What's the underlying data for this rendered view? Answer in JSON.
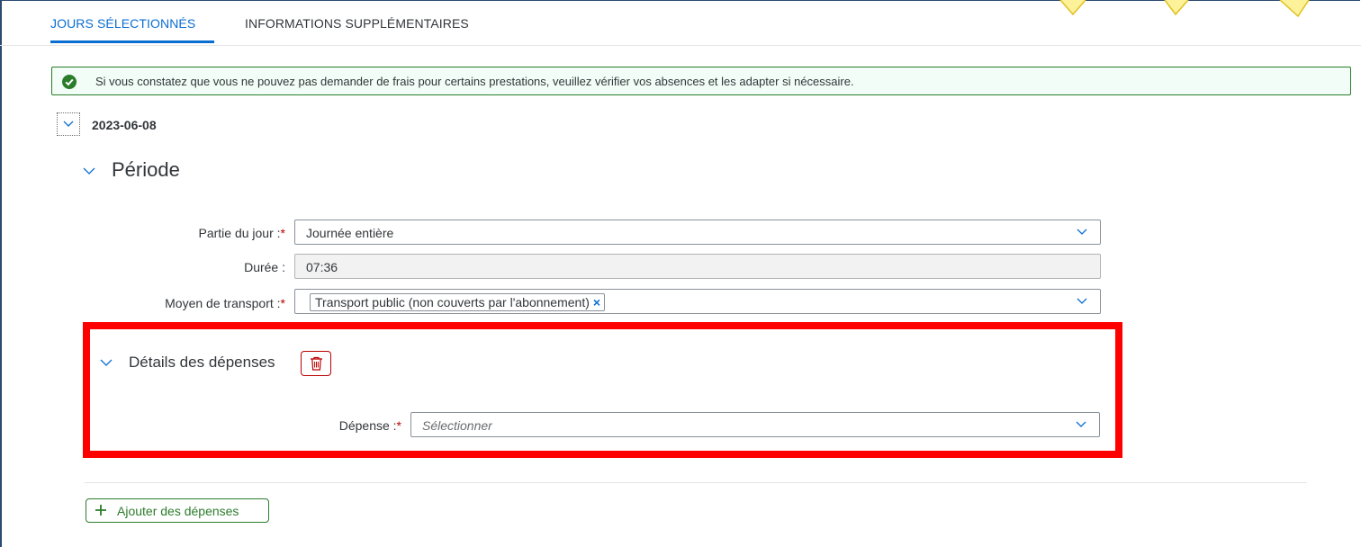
{
  "tabs": {
    "selected_days": "JOURS SÉLECTIONNÉS",
    "additional_info": "INFORMATIONS SUPPLÉMENTAIRES"
  },
  "info_message": {
    "text": "Si vous constatez que vous ne pouvez pas demander de frais pour certains prestations, veuillez vérifier vos absences et les adapter si nécessaire.",
    "icon": "success-check-icon"
  },
  "day": {
    "date": "2023-06-08"
  },
  "period": {
    "title": "Période",
    "fields": {
      "day_part": {
        "label": "Partie du jour :",
        "value": "Journée entière"
      },
      "duration": {
        "label": "Durée :",
        "value": "07:36"
      },
      "transport": {
        "label": "Moyen de transport :",
        "token": "Transport public (non couverts par l'abonnement)"
      }
    },
    "required_marker": "*"
  },
  "expenses": {
    "title": "Détails des dépenses",
    "expense_field": {
      "label": "Dépense :",
      "placeholder": "Sélectionner"
    }
  },
  "add_expenses_button": "Ajouter des dépenses",
  "colors": {
    "accent": "#0a6ed1",
    "success": "#2b7c2b",
    "required": "#bb0000",
    "highlight": "#ff0000"
  }
}
